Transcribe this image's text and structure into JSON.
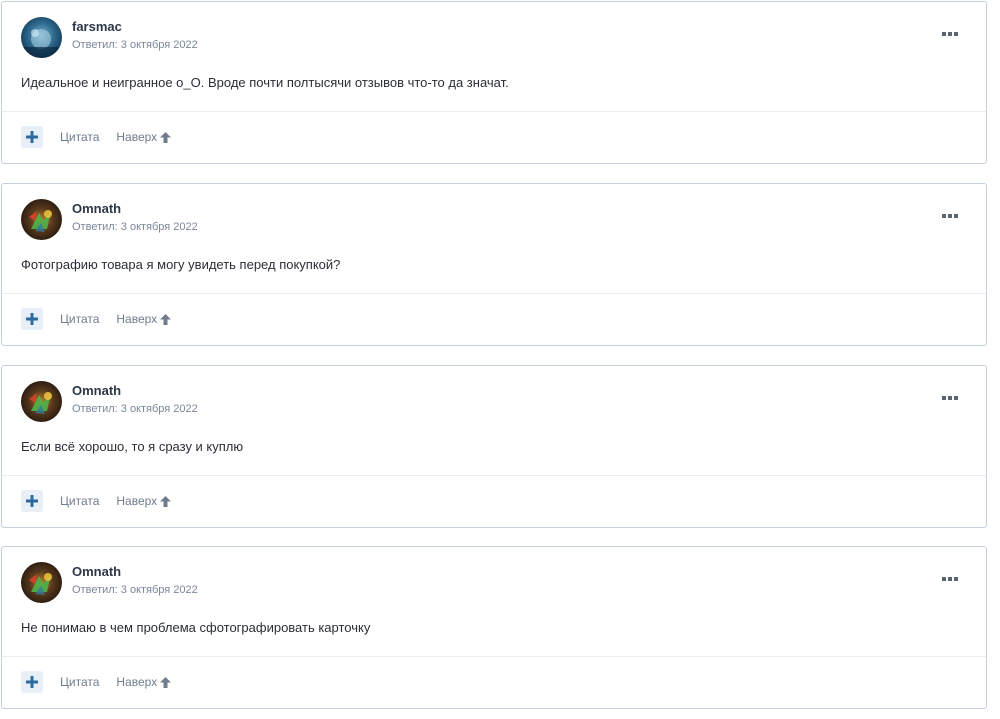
{
  "actions": {
    "quote_label": "Цитата",
    "top_label": "Наверх"
  },
  "colors": {
    "accent": "#2c6aa0",
    "border": "#c5cfdf",
    "muted_text": "#7a8699"
  },
  "posts": [
    {
      "author": "farsmac",
      "meta": "Ответил: 3 октября 2022",
      "content": "Идеальное и неигранное о_О. Вроде почти полтысячи отзывов что-то да значат.",
      "avatar": "farsmac-avatar"
    },
    {
      "author": "Omnath",
      "meta": "Ответил: 3 октября 2022",
      "content": "Фотографию товара я могу увидеть перед покупкой?",
      "avatar": "omnath-avatar"
    },
    {
      "author": "Omnath",
      "meta": "Ответил: 3 октября 2022",
      "content": "Если всё хорошо, то я сразу и куплю",
      "avatar": "omnath-avatar"
    },
    {
      "author": "Omnath",
      "meta": "Ответил: 3 октября 2022",
      "content": "Не понимаю в чем проблема сфотографировать карточку",
      "avatar": "omnath-avatar"
    }
  ]
}
